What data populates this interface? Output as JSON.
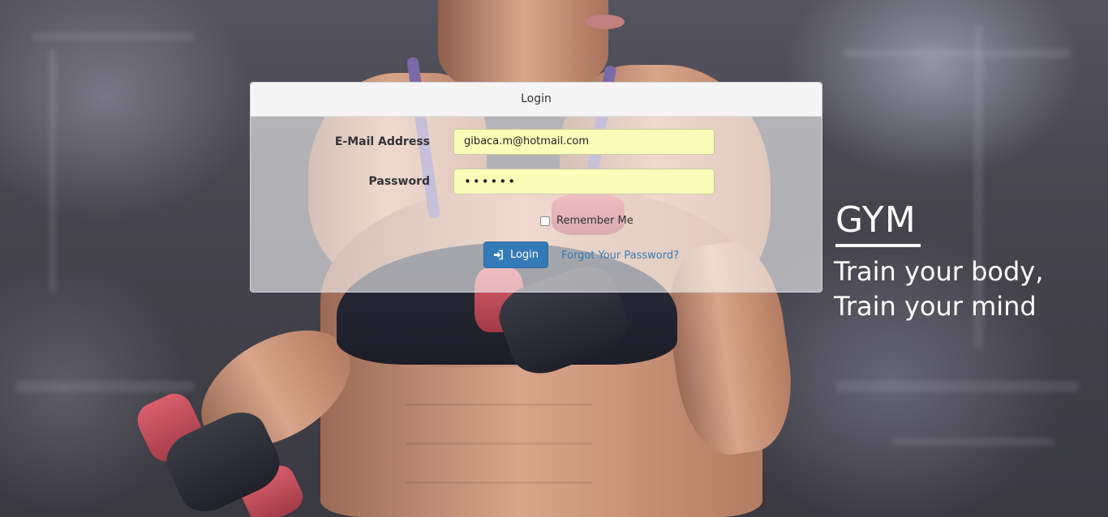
{
  "login_panel": {
    "heading": "Login",
    "email_label": "E-Mail Address",
    "email_value": "gibaca.m@hotmail.com",
    "password_label": "Password",
    "password_value": "••••••",
    "remember_label": "Remember Me",
    "remember_checked": false,
    "login_button_label": "Login",
    "forgot_link": "Forgot Your Password?"
  },
  "brand": {
    "title": "GYM",
    "tagline_line1": "Train your body,",
    "tagline_line2": "Train your mind"
  },
  "colors": {
    "primary": "#337ab7",
    "autofill": "#fafcb8",
    "brand_text": "#ffffff"
  },
  "icons": {
    "login": "sign-in-icon"
  }
}
